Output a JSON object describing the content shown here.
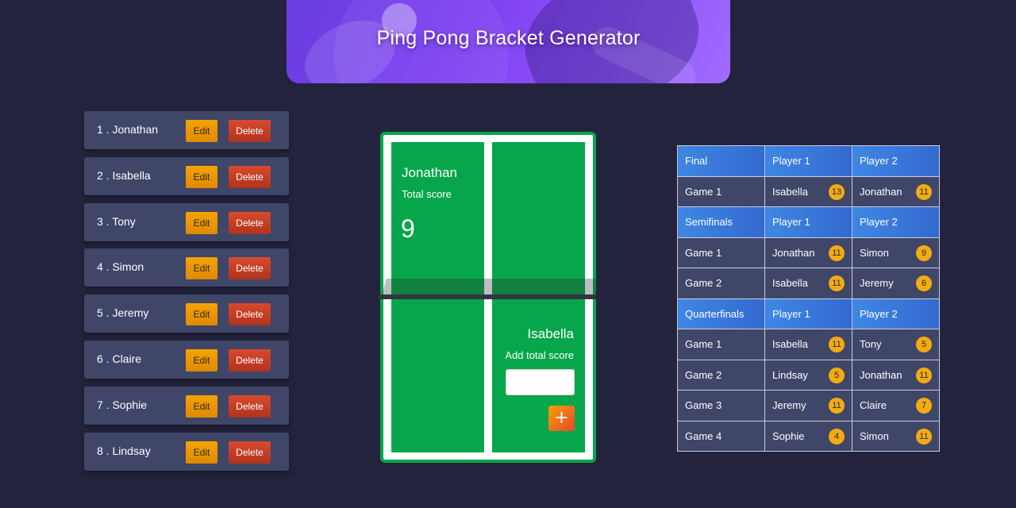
{
  "header": {
    "title": "Ping Pong Bracket Generator"
  },
  "players": [
    {
      "label": "1 .  Jonathan"
    },
    {
      "label": "2 .  Isabella"
    },
    {
      "label": "3 .  Tony"
    },
    {
      "label": "4 .  Simon"
    },
    {
      "label": "5 .  Jeremy"
    },
    {
      "label": "6 .  Claire"
    },
    {
      "label": "7 .  Sophie"
    },
    {
      "label": "8 .  Lindsay"
    }
  ],
  "buttons": {
    "edit": "Edit",
    "delete": "Delete",
    "add": "+"
  },
  "court": {
    "player1": {
      "name": "Jonathan",
      "label": "Total score",
      "score": "9"
    },
    "player2": {
      "name": "Isabella",
      "label": "Add total score",
      "input_value": ""
    }
  },
  "bracket": {
    "sections": [
      {
        "title": "Final",
        "col1": "Player 1",
        "col2": "Player 2",
        "games": [
          {
            "game": "Game 1",
            "p1": "Isabella",
            "s1": "13",
            "p2": "Jonathan",
            "s2": "11"
          }
        ]
      },
      {
        "title": "Semifinals",
        "col1": "Player 1",
        "col2": "Player 2",
        "games": [
          {
            "game": "Game 1",
            "p1": "Jonathan",
            "s1": "11",
            "p2": "Simon",
            "s2": "9"
          },
          {
            "game": "Game 2",
            "p1": "Isabella",
            "s1": "11",
            "p2": "Jeremy",
            "s2": "6"
          }
        ]
      },
      {
        "title": "Quarterfinals",
        "col1": "Player 1",
        "col2": "Player 2",
        "games": [
          {
            "game": "Game 1",
            "p1": "Isabella",
            "s1": "11",
            "p2": "Tony",
            "s2": "5"
          },
          {
            "game": "Game 2",
            "p1": "Lindsay",
            "s1": "5",
            "p2": "Jonathan",
            "s2": "11"
          },
          {
            "game": "Game 3",
            "p1": "Jeremy",
            "s1": "11",
            "p2": "Claire",
            "s2": "7"
          },
          {
            "game": "Game 4",
            "p1": "Sophie",
            "s1": "4",
            "p2": "Simon",
            "s2": "11"
          }
        ]
      }
    ]
  },
  "colors": {
    "background": "#23233d",
    "panel": "#3f4668",
    "edit": "#f5a300",
    "delete": "#c63e25",
    "court_green": "#07a64b",
    "header_blue": "#3f87e3",
    "badge": "#f3ab11",
    "banner_purple": "#7a3df0"
  }
}
